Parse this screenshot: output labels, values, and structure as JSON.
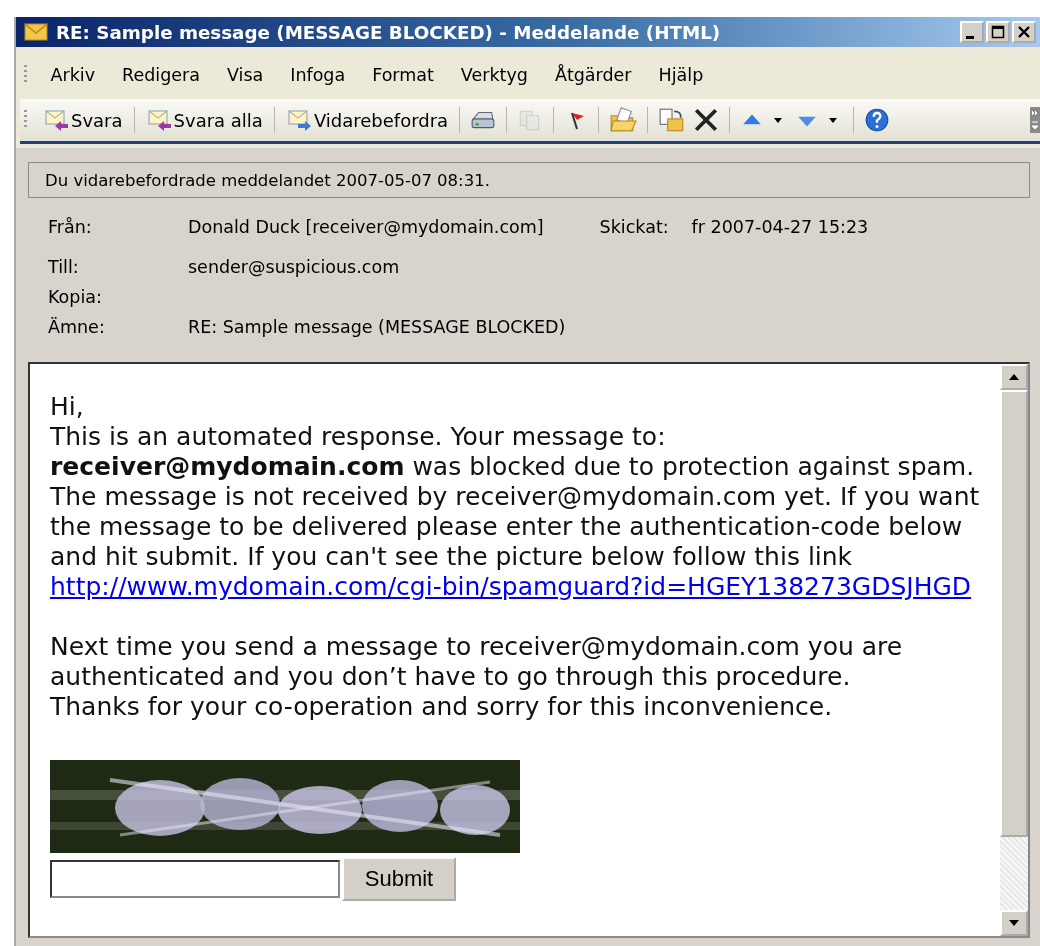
{
  "window": {
    "title": "RE: Sample message (MESSAGE BLOCKED) - Meddelande (HTML)"
  },
  "menu": [
    {
      "label": "Arkiv"
    },
    {
      "label": "Redigera"
    },
    {
      "label": "Visa"
    },
    {
      "label": "Infoga"
    },
    {
      "label": "Format"
    },
    {
      "label": "Verktyg"
    },
    {
      "label": "Åtgärder"
    },
    {
      "label": "Hjälp"
    }
  ],
  "toolbar": [
    {
      "kind": "button",
      "label": "Svara",
      "disabled": false
    },
    {
      "kind": "button",
      "label": "Svara alla",
      "disabled": false
    },
    {
      "kind": "button",
      "label": "Vidarebefordra",
      "disabled": false
    },
    {
      "kind": "icon",
      "disabled": false
    },
    {
      "kind": "icon",
      "disabled": true
    },
    {
      "kind": "icon",
      "disabled": false
    },
    {
      "kind": "icon",
      "disabled": false
    },
    {
      "kind": "icon",
      "disabled": false
    },
    {
      "kind": "icon",
      "disabled": false
    },
    {
      "kind": "icon",
      "disabled": false
    },
    {
      "kind": "icon",
      "disabled": false
    },
    {
      "kind": "icon",
      "disabled": false
    }
  ],
  "info_bar": "Du vidarebefordrade meddelandet 2007-05-07 08:31.",
  "header": {
    "from_label": "Från:",
    "from": "Donald Duck [receiver@mydomain.com]",
    "sent_label": "Skickat:",
    "sent": "fr 2007-04-27 15:23",
    "to_label": "Till:",
    "to": "sender@suspicious.com",
    "cc_label": "Kopia:",
    "subject_label": "Ämne:",
    "subject": "RE: Sample message (MESSAGE BLOCKED)"
  },
  "body": {
    "paragraph_1": [
      "Hi,",
      "This is an automated response. Your message to:",
      "**receiver@mydomain.com** was blocked due to protection against spam.",
      "The message is not received by receiver@mydomain.com yet. If you want",
      "the message to be delivered please enter the authentication-code below",
      "and hit submit. If you can't see the picture below follow this link"
    ],
    "link": "http://www.mydomain.com/cgi-bin/spamguard?id=HGEY138273GDSJHGD",
    "paragraph_2": [
      "Next time you send a message to receiver@mydomain.com you are",
      "authenticated and you don’t have to go through this procedure.",
      "Thanks for your co-operation and sorry for this inconvenience."
    ],
    "submit": "Submit"
  }
}
